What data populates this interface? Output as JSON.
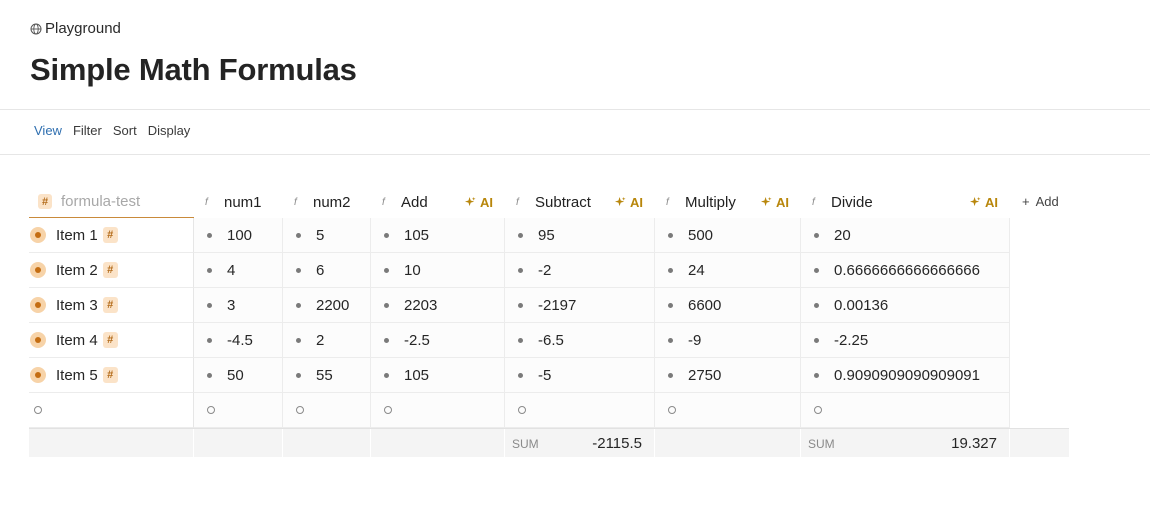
{
  "breadcrumb": {
    "label": "Playground",
    "icon": "globe-icon"
  },
  "page": {
    "title": "Simple Math Formulas"
  },
  "toolbar": {
    "view": "View",
    "filter": "Filter",
    "sort": "Sort",
    "display": "Display"
  },
  "table": {
    "title_column": "formula-test",
    "columns": [
      {
        "label": "num1",
        "ai": false
      },
      {
        "label": "num2",
        "ai": false
      },
      {
        "label": "Add",
        "ai": true
      },
      {
        "label": "Subtract",
        "ai": true
      },
      {
        "label": "Multiply",
        "ai": true
      },
      {
        "label": "Divide",
        "ai": true
      }
    ],
    "ai_label": "AI",
    "add_label": "Add",
    "rows": [
      {
        "name": "Item 1",
        "values": [
          "100",
          "5",
          "105",
          "95",
          "500",
          "20"
        ]
      },
      {
        "name": "Item 2",
        "values": [
          "4",
          "6",
          "10",
          "-2",
          "24",
          "0.6666666666666666"
        ]
      },
      {
        "name": "Item 3",
        "values": [
          "3",
          "2200",
          "2203",
          "-2197",
          "6600",
          "0.00136"
        ]
      },
      {
        "name": "Item 4",
        "values": [
          "-4.5",
          "2",
          "-2.5",
          "-6.5",
          "-9",
          "-2.25"
        ]
      },
      {
        "name": "Item 5",
        "values": [
          "50",
          "55",
          "105",
          "-5",
          "2750",
          "0.9090909090909091"
        ]
      }
    ],
    "footer": {
      "subtract": {
        "label": "SUM",
        "value": "-2115.5"
      },
      "divide": {
        "label": "SUM",
        "value": "19.327"
      }
    }
  },
  "colors": {
    "accent": "#2f6fb0",
    "ai": "#b8860b",
    "badge_bg": "#fbe3c8",
    "badge_fg": "#b36b1a"
  }
}
